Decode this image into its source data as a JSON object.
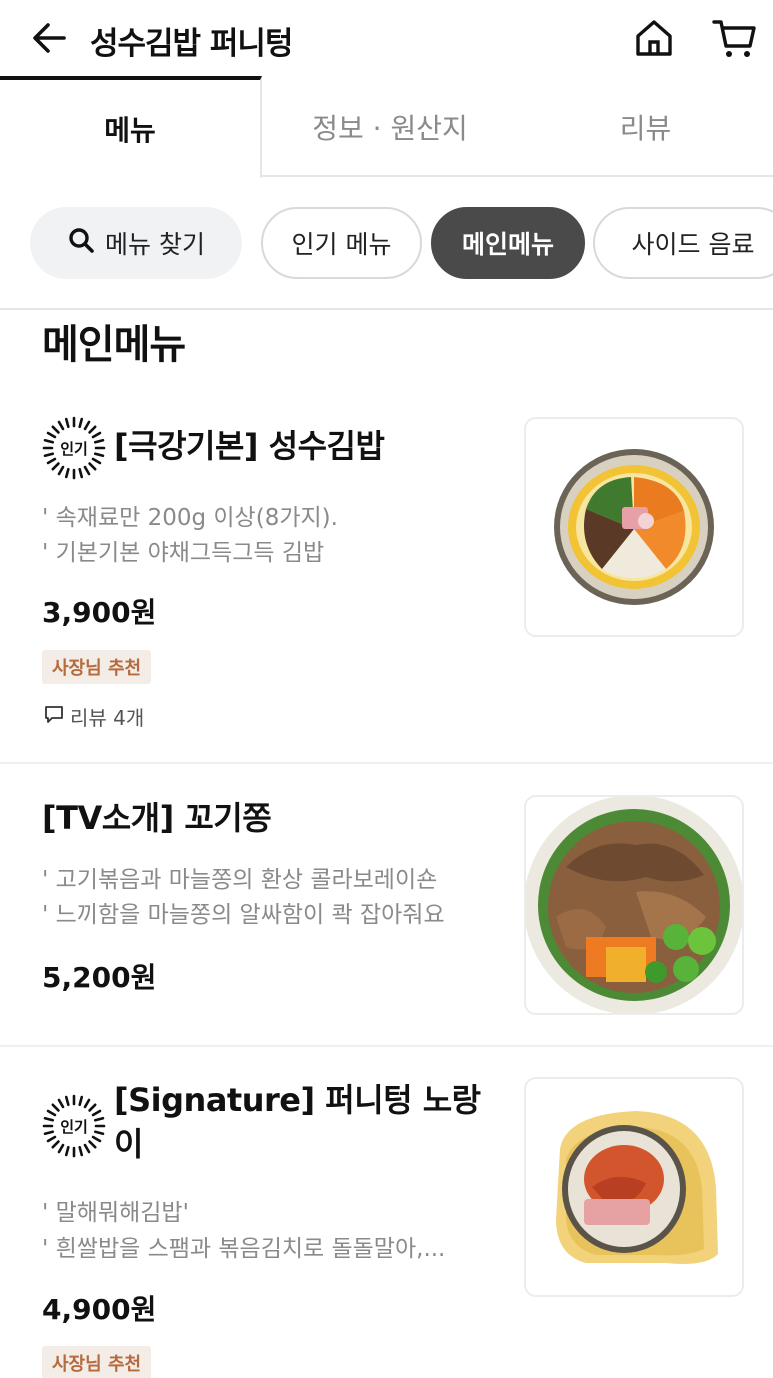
{
  "header": {
    "title": "성수김밥 퍼니텅"
  },
  "tabs": [
    {
      "label": "메뉴"
    },
    {
      "label": "정보 · 원산지"
    },
    {
      "label": "리뷰"
    }
  ],
  "chips": {
    "search": "메뉴 찾기",
    "items": [
      "인기 메뉴",
      "메인메뉴",
      "사이드 음료"
    ]
  },
  "section_title": "메인메뉴",
  "menu_items": [
    {
      "popular_badge": "인기",
      "name": "[극강기본] 성수김밥",
      "desc1": "' 속재료만 200g 이상(8가지).",
      "desc2": "' 기본기본 야채그득그득 김밥",
      "price": "3,900원",
      "recommend": "사장님 추천",
      "review": "리뷰 4개"
    },
    {
      "name": "[TV소개] 꼬기쫑",
      "desc1": "' 고기볶음과 마늘쫑의 환상 콜라보레이숀",
      "desc2": "' 느끼함을 마늘쫑의 알싸함이 콱 잡아줘요",
      "price": "5,200원"
    },
    {
      "popular_badge": "인기",
      "name_line1": "[Signature] 퍼니텅 노랑",
      "name_line2": "이",
      "desc1": "' 말해뭐해김밥'",
      "desc2": "' 흰쌀밥을 스팸과 볶음김치로 돌돌말아,...",
      "price": "4,900원",
      "recommend": "사장님 추천"
    }
  ]
}
